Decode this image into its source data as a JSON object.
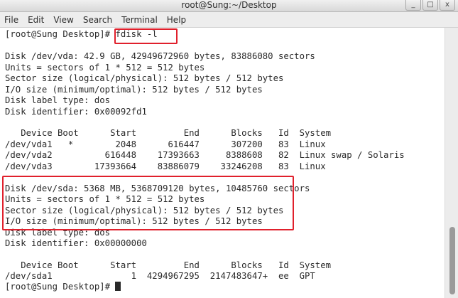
{
  "window": {
    "title": "root@Sung:~/Desktop",
    "minimize_glyph": "_",
    "maximize_glyph": "□",
    "close_glyph": "x"
  },
  "menu": [
    "File",
    "Edit",
    "View",
    "Search",
    "Terminal",
    "Help"
  ],
  "terminal": {
    "lines": [
      "[root@Sung Desktop]# fdisk -l",
      "",
      "Disk /dev/vda: 42.9 GB, 42949672960 bytes, 83886080 sectors",
      "Units = sectors of 1 * 512 = 512 bytes",
      "Sector size (logical/physical): 512 bytes / 512 bytes",
      "I/O size (minimum/optimal): 512 bytes / 512 bytes",
      "Disk label type: dos",
      "Disk identifier: 0x00092fd1",
      "",
      "   Device Boot      Start         End      Blocks   Id  System",
      "/dev/vda1   *        2048      616447      307200   83  Linux",
      "/dev/vda2          616448    17393663     8388608   82  Linux swap / Solaris",
      "/dev/vda3        17393664    83886079    33246208   83  Linux",
      "",
      "Disk /dev/sda: 5368 MB, 5368709120 bytes, 10485760 sectors",
      "Units = sectors of 1 * 512 = 512 bytes",
      "Sector size (logical/physical): 512 bytes / 512 bytes",
      "I/O size (minimum/optimal): 512 bytes / 512 bytes",
      "Disk label type: dos",
      "Disk identifier: 0x00000000",
      "",
      "   Device Boot      Start         End      Blocks   Id  System",
      "/dev/sda1               1  4294967295  2147483647+  ee  GPT",
      "[root@Sung Desktop]# "
    ]
  }
}
